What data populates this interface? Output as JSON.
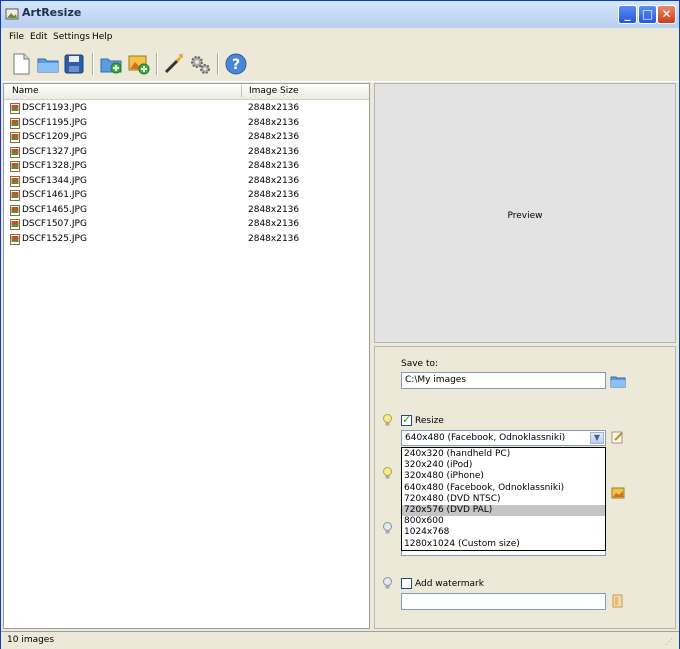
{
  "window": {
    "title": "ArtResize"
  },
  "menu": [
    "File",
    "Edit",
    "Settings",
    "Help"
  ],
  "toolbar": {
    "icons": [
      "new-file-icon",
      "open-folder-icon",
      "save-icon",
      "add-folder-icon",
      "add-images-icon",
      "magic-wand-icon",
      "gears-icon",
      "help-icon"
    ]
  },
  "file_list": {
    "columns": [
      "Name",
      "Image Size"
    ],
    "rows": [
      {
        "name": "DSCF1193.JPG",
        "size": "2848x2136"
      },
      {
        "name": "DSCF1195.JPG",
        "size": "2848x2136"
      },
      {
        "name": "DSCF1209.JPG",
        "size": "2848x2136"
      },
      {
        "name": "DSCF1327.JPG",
        "size": "2848x2136"
      },
      {
        "name": "DSCF1328.JPG",
        "size": "2848x2136"
      },
      {
        "name": "DSCF1344.JPG",
        "size": "2848x2136"
      },
      {
        "name": "DSCF1461.JPG",
        "size": "2848x2136"
      },
      {
        "name": "DSCF1465.JPG",
        "size": "2848x2136"
      },
      {
        "name": "DSCF1507.JPG",
        "size": "2848x2136"
      },
      {
        "name": "DSCF1525.JPG",
        "size": "2848x2136"
      }
    ]
  },
  "preview": {
    "label": "Preview"
  },
  "settings": {
    "save_to_label": "Save to:",
    "save_to_value": "C:\\My images",
    "resize_label": "Resize",
    "resize_checked": true,
    "resize_selected": "640x480 (Facebook, Odnoklassniki)",
    "resize_options": [
      "240x320 (handheld PC)",
      "320x240 (iPod)",
      "320x480 (iPhone)",
      "640x480 (Facebook, Odnoklassniki)",
      "720x480 (DVD NTSC)",
      "720x576 (DVD PAL)",
      "800x600",
      "1024x768",
      "1280x1024 (Custom size)"
    ],
    "highlighted_option": "720x576 (DVD PAL)",
    "watermark_label": "Add watermark",
    "watermark_checked": false,
    "watermark_value": ""
  },
  "status": {
    "text": "10 images"
  }
}
